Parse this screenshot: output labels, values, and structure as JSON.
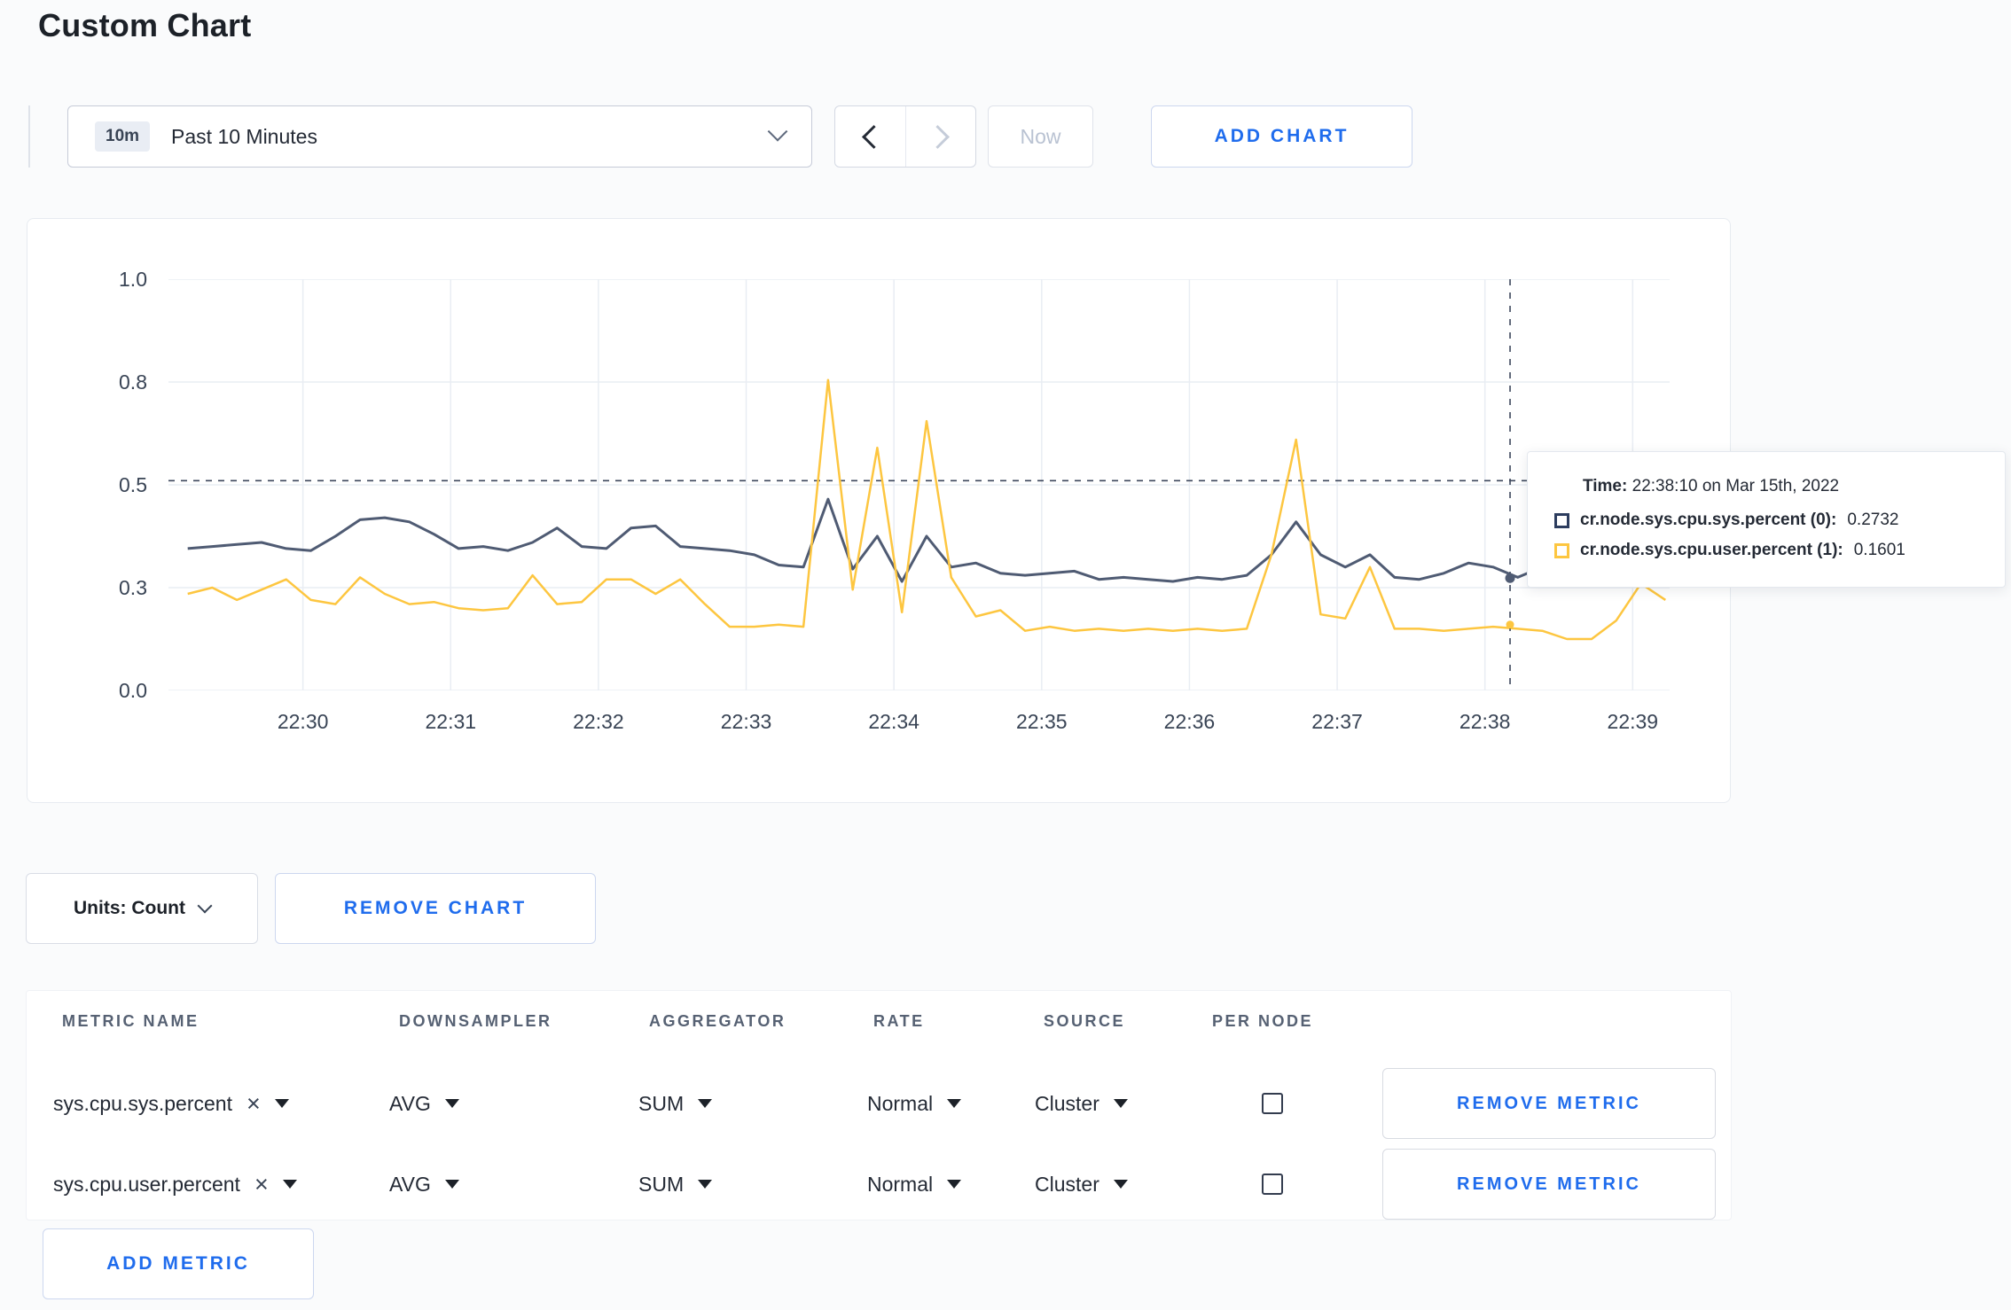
{
  "page": {
    "title": "Custom Chart"
  },
  "icons": {
    "close": "×"
  },
  "toolbar": {
    "time_window": {
      "badge": "10m",
      "label": "Past 10 Minutes"
    },
    "now_label": "Now",
    "add_chart_label": "ADD CHART"
  },
  "controls": {
    "units_label": "Units: Count",
    "remove_chart_label": "REMOVE CHART"
  },
  "metrics_table": {
    "headers": [
      "METRIC NAME",
      "DOWNSAMPLER",
      "AGGREGATOR",
      "RATE",
      "SOURCE",
      "PER NODE"
    ],
    "rows": [
      {
        "metric": "sys.cpu.sys.percent",
        "downsampler": "AVG",
        "aggregator": "SUM",
        "rate": "Normal",
        "source": "Cluster",
        "per_node_checked": false,
        "remove_label": "REMOVE METRIC"
      },
      {
        "metric": "sys.cpu.user.percent",
        "downsampler": "AVG",
        "aggregator": "SUM",
        "rate": "Normal",
        "source": "Cluster",
        "per_node_checked": false,
        "remove_label": "REMOVE METRIC"
      }
    ],
    "add_metric_label": "ADD METRIC"
  },
  "colors": {
    "accent": "#1f6ced",
    "grid": "#e9edf3",
    "crosshair": "#3c475c"
  },
  "chart_data": {
    "type": "line",
    "title": "",
    "x_axis": {
      "min": -0.91,
      "max": 9.25,
      "ticks": [
        0,
        1,
        2,
        3,
        4,
        5,
        6,
        7,
        8,
        9
      ],
      "tick_labels": [
        "22:30",
        "22:31",
        "22:32",
        "22:33",
        "22:34",
        "22:35",
        "22:36",
        "22:37",
        "22:38",
        "22:39"
      ]
    },
    "y_axis": {
      "min": 0,
      "max": 1,
      "gridlines": [
        0,
        0.25,
        0.5,
        0.75,
        1
      ],
      "tick_labels": [
        "0.0",
        "0.3",
        "0.5",
        "0.8",
        "1.0"
      ]
    },
    "threshold_line": 0.51,
    "crosshair_x": 8.17,
    "series": [
      {
        "name": "cr.node.sys.cpu.sys.percent",
        "color": "#4f5b73",
        "x_start": -0.78,
        "x_step": 0.1667,
        "hover_value": 0.2732,
        "values": [
          0.345,
          0.35,
          0.355,
          0.36,
          0.345,
          0.34,
          0.375,
          0.415,
          0.42,
          0.41,
          0.38,
          0.345,
          0.35,
          0.34,
          0.36,
          0.395,
          0.35,
          0.345,
          0.395,
          0.4,
          0.35,
          0.345,
          0.34,
          0.33,
          0.305,
          0.3,
          0.465,
          0.295,
          0.375,
          0.265,
          0.375,
          0.3,
          0.31,
          0.285,
          0.28,
          0.285,
          0.29,
          0.27,
          0.275,
          0.27,
          0.265,
          0.275,
          0.27,
          0.28,
          0.33,
          0.41,
          0.33,
          0.3,
          0.33,
          0.275,
          0.27,
          0.285,
          0.31,
          0.3,
          0.275,
          0.3,
          0.295,
          0.27,
          0.285,
          0.3,
          0.29
        ]
      },
      {
        "name": "cr.node.sys.cpu.user.percent",
        "color": "#fdc640",
        "x_start": -0.78,
        "x_step": 0.1667,
        "hover_value": 0.1601,
        "values": [
          0.235,
          0.25,
          0.22,
          0.245,
          0.27,
          0.22,
          0.21,
          0.275,
          0.235,
          0.21,
          0.215,
          0.2,
          0.195,
          0.2,
          0.28,
          0.21,
          0.215,
          0.27,
          0.27,
          0.235,
          0.27,
          0.21,
          0.155,
          0.155,
          0.16,
          0.155,
          0.755,
          0.245,
          0.59,
          0.19,
          0.655,
          0.275,
          0.18,
          0.195,
          0.145,
          0.155,
          0.145,
          0.15,
          0.145,
          0.15,
          0.145,
          0.15,
          0.145,
          0.15,
          0.33,
          0.61,
          0.185,
          0.175,
          0.3,
          0.15,
          0.15,
          0.145,
          0.15,
          0.155,
          0.15,
          0.145,
          0.125,
          0.125,
          0.17,
          0.26,
          0.22
        ]
      }
    ],
    "tooltip": {
      "time_label": "Time:",
      "time_value": "22:38:10 on Mar 15th, 2022",
      "entries": [
        {
          "label": "cr.node.sys.cpu.sys.percent (0):",
          "value": "0.2732",
          "color": "#2c3c5e"
        },
        {
          "label": "cr.node.sys.cpu.user.percent (1):",
          "value": "0.1601",
          "color": "#fdc640"
        }
      ]
    }
  }
}
